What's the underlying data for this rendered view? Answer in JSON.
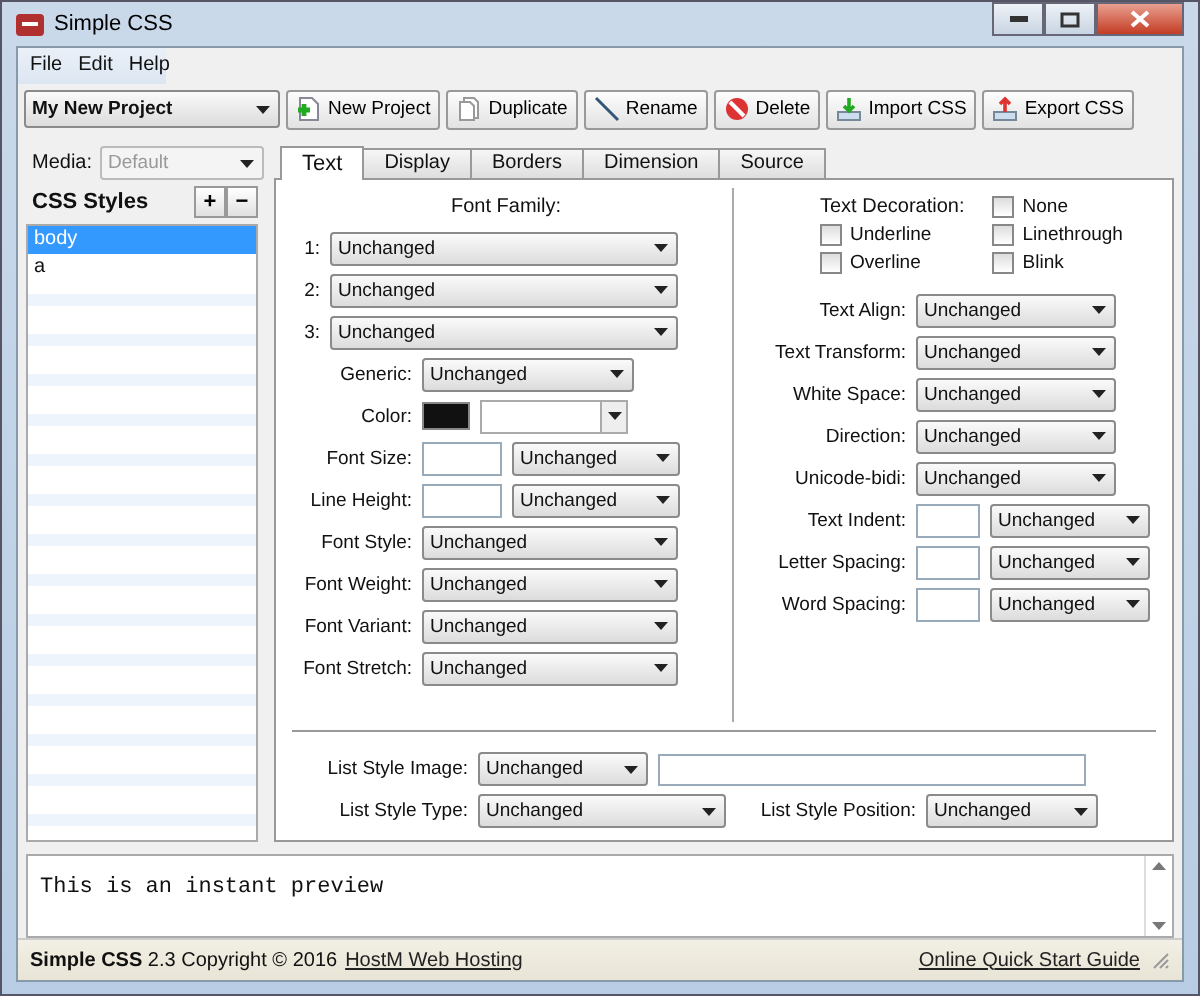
{
  "window": {
    "title": "Simple CSS"
  },
  "menu": [
    {
      "label": "File"
    },
    {
      "label": "Edit"
    },
    {
      "label": "Help"
    }
  ],
  "project": {
    "value": "My New Project"
  },
  "toolbar": [
    {
      "label": "New Project",
      "kind": "new"
    },
    {
      "label": "Duplicate",
      "kind": "duplicate"
    },
    {
      "label": "Rename",
      "kind": "rename"
    },
    {
      "label": "Delete",
      "kind": "delete"
    },
    {
      "label": "Import CSS",
      "kind": "import"
    },
    {
      "label": "Export CSS",
      "kind": "export"
    }
  ],
  "sidebar": {
    "media_label": "Media:",
    "media": {
      "value": "Default",
      "disabled": true
    },
    "title": "CSS Styles",
    "add": "+",
    "remove": "−",
    "items": [
      {
        "label": "body",
        "selected": true
      },
      {
        "label": "a",
        "selected": false
      }
    ]
  },
  "tabs": [
    {
      "label": "Text",
      "selected": true
    },
    {
      "label": "Display",
      "selected": false
    },
    {
      "label": "Borders",
      "selected": false
    },
    {
      "label": "Dimension",
      "selected": false
    },
    {
      "label": "Source",
      "selected": false
    }
  ],
  "font_family": {
    "heading": "Font Family:",
    "rows": [
      {
        "label": "1:",
        "value": "Unchanged"
      },
      {
        "label": "2:",
        "value": "Unchanged"
      },
      {
        "label": "3:",
        "value": "Unchanged"
      }
    ]
  },
  "left_rows": [
    {
      "kind": "select",
      "label": "Generic:",
      "value": "Unchanged"
    },
    {
      "kind": "color",
      "label": "Color:"
    },
    {
      "kind": "size",
      "label": "Font Size:",
      "value": "Unchanged"
    },
    {
      "kind": "size",
      "label": "Line Height:",
      "value": "Unchanged"
    },
    {
      "kind": "long_select",
      "label": "Font Style:",
      "value": "Unchanged"
    },
    {
      "kind": "long_select",
      "label": "Font Weight:",
      "value": "Unchanged"
    },
    {
      "kind": "long_select",
      "label": "Font Variant:",
      "value": "Unchanged"
    },
    {
      "kind": "long_select",
      "label": "Font Stretch:",
      "value": "Unchanged"
    }
  ],
  "text_decoration": {
    "label": "Text Decoration:",
    "options": [
      {
        "label": "None",
        "checked": false
      },
      {
        "label": "Underline",
        "checked": false
      },
      {
        "label": "Linethrough",
        "checked": false
      },
      {
        "label": "Overline",
        "checked": false
      },
      {
        "label": "Blink",
        "checked": false
      }
    ]
  },
  "right_rows": [
    {
      "kind": "select",
      "label": "Text Align:",
      "value": "Unchanged"
    },
    {
      "kind": "select",
      "label": "Text Transform:",
      "value": "Unchanged"
    },
    {
      "kind": "select",
      "label": "White Space:",
      "value": "Unchanged"
    },
    {
      "kind": "select",
      "label": "Direction:",
      "value": "Unchanged"
    },
    {
      "kind": "select",
      "label": "Unicode-bidi:",
      "value": "Unchanged"
    },
    {
      "kind": "size",
      "label": "Text Indent:",
      "value": "Unchanged"
    },
    {
      "kind": "size",
      "label": "Letter Spacing:",
      "value": "Unchanged"
    },
    {
      "kind": "size",
      "label": "Word Spacing:",
      "value": "Unchanged"
    }
  ],
  "list_style": {
    "image_label": "List Style Image:",
    "image": "Unchanged",
    "type_label": "List Style Type:",
    "type": "Unchanged",
    "position_label": "List Style Position:",
    "position": "Unchanged"
  },
  "preview": {
    "text": "This is an instant preview"
  },
  "status_bar": {
    "text": "**Simple CSS** 2.3 Copyright © 2016",
    "link": "HostM Web Hosting",
    "guide": "Online Quick Start Guide"
  }
}
